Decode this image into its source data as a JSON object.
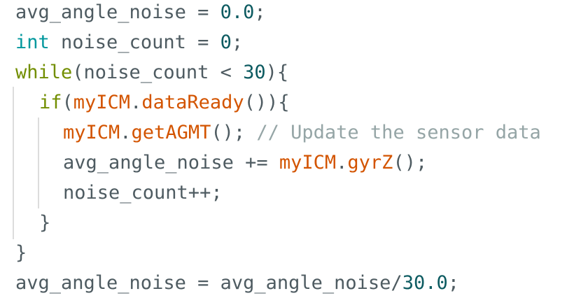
{
  "code": {
    "lines": [
      {
        "indent": 0,
        "tokens": [
          {
            "text": "avg_angle_noise = ",
            "kind": "default"
          },
          {
            "text": "0.0",
            "kind": "number"
          },
          {
            "text": ";",
            "kind": "default"
          }
        ]
      },
      {
        "indent": 0,
        "tokens": [
          {
            "text": "int",
            "kind": "type"
          },
          {
            "text": " noise_count = ",
            "kind": "default"
          },
          {
            "text": "0",
            "kind": "number"
          },
          {
            "text": ";",
            "kind": "default"
          }
        ]
      },
      {
        "indent": 0,
        "tokens": [
          {
            "text": "while",
            "kind": "keyword"
          },
          {
            "text": "(noise_count < ",
            "kind": "default"
          },
          {
            "text": "30",
            "kind": "number"
          },
          {
            "text": "){",
            "kind": "default"
          }
        ]
      },
      {
        "indent": 1,
        "tokens": [
          {
            "text": "if",
            "kind": "keyword"
          },
          {
            "text": "(",
            "kind": "default"
          },
          {
            "text": "myICM",
            "kind": "obj"
          },
          {
            "text": ".",
            "kind": "default"
          },
          {
            "text": "dataReady",
            "kind": "method"
          },
          {
            "text": "()){",
            "kind": "default"
          }
        ]
      },
      {
        "indent": 2,
        "tokens": [
          {
            "text": "myICM",
            "kind": "obj"
          },
          {
            "text": ".",
            "kind": "default"
          },
          {
            "text": "getAGMT",
            "kind": "method"
          },
          {
            "text": "(); ",
            "kind": "default"
          },
          {
            "text": "// Update the sensor data",
            "kind": "comment"
          }
        ]
      },
      {
        "indent": 2,
        "tokens": [
          {
            "text": "avg_angle_noise += ",
            "kind": "default"
          },
          {
            "text": "myICM",
            "kind": "obj"
          },
          {
            "text": ".",
            "kind": "default"
          },
          {
            "text": "gyrZ",
            "kind": "method"
          },
          {
            "text": "();",
            "kind": "default"
          }
        ]
      },
      {
        "indent": 2,
        "tokens": [
          {
            "text": "noise_count++;",
            "kind": "default"
          }
        ]
      },
      {
        "indent": 1,
        "tokens": [
          {
            "text": "}",
            "kind": "default"
          }
        ]
      },
      {
        "indent": 0,
        "tokens": [
          {
            "text": "}",
            "kind": "default"
          }
        ]
      },
      {
        "indent": 0,
        "tokens": [
          {
            "text": "avg_angle_noise = avg_angle_noise/",
            "kind": "default"
          },
          {
            "text": "30.0",
            "kind": "number"
          },
          {
            "text": ";",
            "kind": "default"
          }
        ]
      }
    ]
  },
  "colors": {
    "background": "#ffffff",
    "default": "#4e5b61",
    "number": "#0d5b61",
    "type": "#00979d",
    "keyword": "#728e00",
    "object": "#d35400",
    "method": "#d35400",
    "comment": "#95a5a6",
    "indent_guide": "#dcdcdc"
  }
}
